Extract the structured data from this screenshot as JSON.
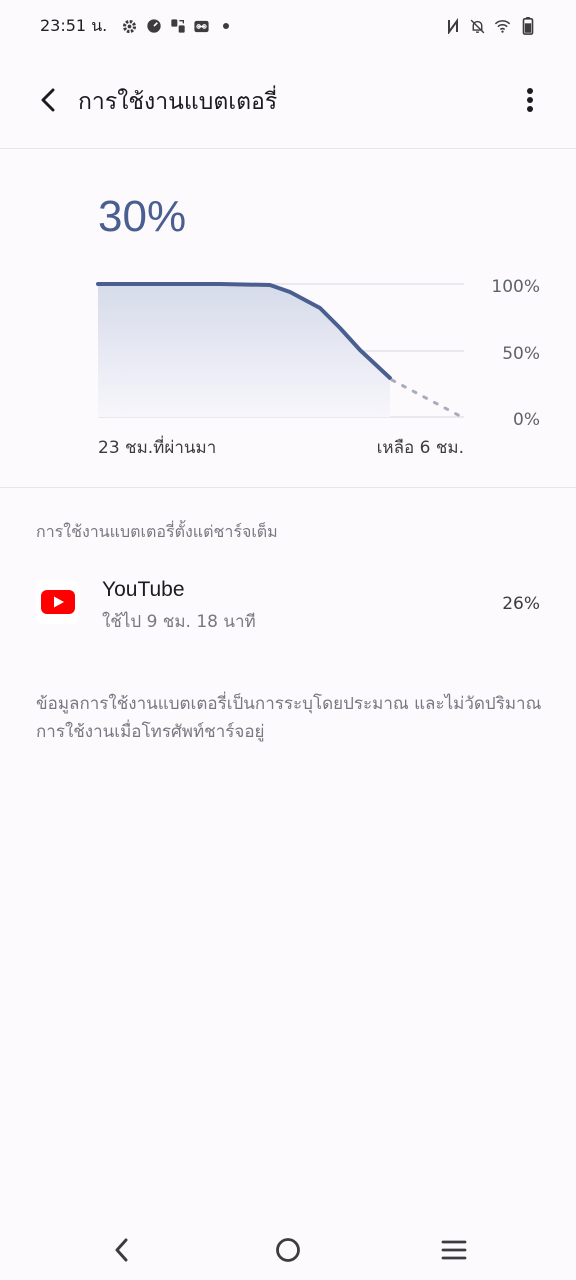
{
  "status_bar": {
    "time": "23:51 น.",
    "left_icons": [
      "gear-icon",
      "speedometer-icon",
      "app-transfer-icon",
      "link-icon",
      "dot-icon"
    ],
    "right_icons": [
      "nfc-icon",
      "bell-off-icon",
      "wifi-icon",
      "battery-icon"
    ]
  },
  "header": {
    "title": "การใช้งานแบตเตอรี่"
  },
  "battery": {
    "percent": "30%",
    "chart_axis": {
      "y_ticks": [
        "100%",
        "50%",
        "0%"
      ],
      "left_caption": "23 ชม.ที่ผ่านมา",
      "right_caption": "เหลือ 6 ชม."
    },
    "accent_color": "#4a5f8f"
  },
  "usage_section": {
    "header": "การใช้งานแบตเตอรี่ตั้งแต่ชาร์จเต็ม",
    "apps": [
      {
        "name": "YouTube",
        "usage": "ใช้ไป 9 ชม. 18 นาที",
        "percent": "26%",
        "icon": "youtube-icon"
      }
    ]
  },
  "footnote": "ข้อมูลการใช้งานแบตเตอรี่เป็นการระบุโดยประมาณ และไม่วัดปริมาณการใช้งานเมื่อโทรศัพท์ชาร์จอยู่",
  "nav_bar": {
    "buttons": [
      "back-nav-icon",
      "home-nav-icon",
      "recents-nav-icon"
    ]
  }
}
